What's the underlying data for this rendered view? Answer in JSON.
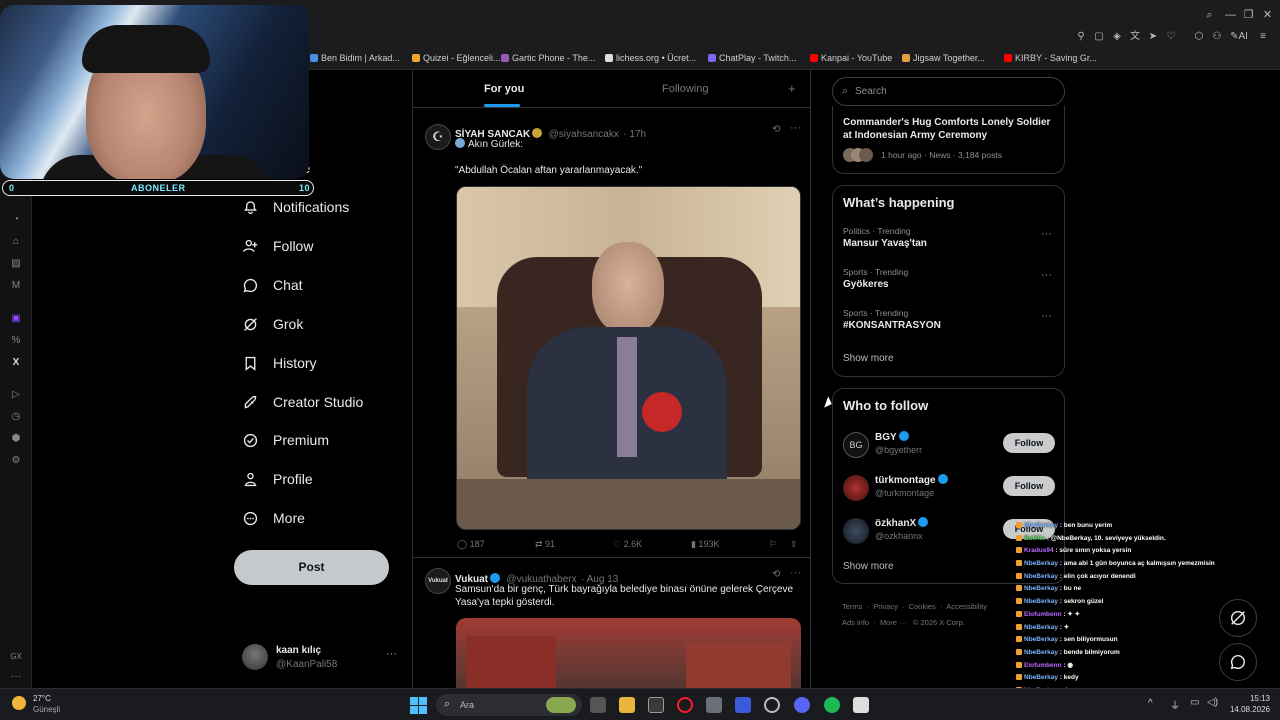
{
  "browser": {
    "bookmarks": [
      {
        "label": "Ben Bidim | Arkad...",
        "color": "#4a90e2"
      },
      {
        "label": "Quizei - Eğlenceli...",
        "color": "#f5a623"
      },
      {
        "label": "Gartic Phone - The...",
        "color": "#9b59b6"
      },
      {
        "label": "lichess.org • Ücret...",
        "color": "#dddddd"
      },
      {
        "label": "ChatPlay - Twitch...",
        "color": "#7b68ee"
      },
      {
        "label": "Kanpai - YouTube",
        "color": "#ff0000"
      },
      {
        "label": "Jigsaw Together...",
        "color": "#e0a040"
      },
      {
        "label": "KIRBY - Saving Gr...",
        "color": "#ff0000"
      }
    ]
  },
  "webcam": {
    "subscriber_label": "ABONELER",
    "sub_current": "0",
    "sub_goal": "10"
  },
  "sidebar": {
    "cut_label": "ore",
    "items": [
      {
        "label": "Notifications",
        "icon": "bell-icon"
      },
      {
        "label": "Follow",
        "icon": "person-add-icon"
      },
      {
        "label": "Chat",
        "icon": "chat-bubble-icon"
      },
      {
        "label": "Grok",
        "icon": "grok-icon"
      },
      {
        "label": "History",
        "icon": "bookmark-icon"
      },
      {
        "label": "Creator Studio",
        "icon": "rocket-icon"
      },
      {
        "label": "Premium",
        "icon": "verified-badge-icon"
      },
      {
        "label": "Profile",
        "icon": "person-icon"
      },
      {
        "label": "More",
        "icon": "more-circle-icon"
      }
    ],
    "post_label": "Post",
    "user": {
      "name": "kaan kılıç",
      "handle": "@KaanPali58"
    }
  },
  "feed": {
    "tabs": [
      "For you",
      "Following"
    ],
    "add_tab": "+",
    "tweets": [
      {
        "name": "SİYAH SANCAK",
        "handle": "@siyahsancakx",
        "time": "· 17h",
        "attribution": "Akın Gürlek:",
        "text": "\"Abdullah Öcalan aftan yararlanmayacak.\"",
        "replies": "187",
        "reposts": "91",
        "likes": "2.6K",
        "views": "193K"
      },
      {
        "name": "Vukuat",
        "handle": "@vukuathaberx",
        "time": "· Aug 13",
        "text": "Samsun'da bir genç, Türk bayrağıyla belediye binası önüne gelerek Çerçeve Yasa'ya tepki gösterdi."
      }
    ]
  },
  "right": {
    "search_placeholder": "Search",
    "news": {
      "title": "Commander's Hug Comforts Lonely Soldier at Indonesian Army Ceremony",
      "meta": "1 hour ago · News · 3,184 posts"
    },
    "happening_title": "What’s happening",
    "trends": [
      {
        "cat": "Politics · Trending",
        "name": "Mansur Yavaş'tan"
      },
      {
        "cat": "Sports · Trending",
        "name": "Gyökeres"
      },
      {
        "cat": "Sports · Trending",
        "name": "#KONSANTRASYON"
      }
    ],
    "show_more": "Show more",
    "wtf_title": "Who to follow",
    "follow_label": "Follow",
    "wtf": [
      {
        "name": "BGY",
        "handle": "@bgyetherr"
      },
      {
        "name": "türkmontage",
        "handle": "@turkmontage"
      },
      {
        "name": "özkhanX",
        "handle": "@ozkhannx"
      }
    ],
    "footer": [
      "Terms",
      "Privacy",
      "Cookies",
      "Accessibility",
      "Ads info",
      "More ···",
      "© 2026 X Corp."
    ]
  },
  "chat": [
    {
      "user": "NbeBerkay",
      "msg": " : ben bunu yerim",
      "color": "#7cb3ff"
    },
    {
      "user": "BotRix",
      "msg": " : @NbeBerkay, 10. seviyeye yükseldin.",
      "color": "#5bd65b"
    },
    {
      "user": "Kradus94",
      "msg": " : süre sının yoksa yersin",
      "color": "#b86bff"
    },
    {
      "user": "NbeBerkay",
      "msg": " : ama abi 1 gün boyunca aç kalmışsın yemezmisin",
      "color": "#7cb3ff"
    },
    {
      "user": "NbeBerkay",
      "msg": " : elin çok acıyor denendi",
      "color": "#7cb3ff"
    },
    {
      "user": "NbeBerkay",
      "msg": " : bu ne",
      "color": "#7cb3ff"
    },
    {
      "user": "NbeBerkay",
      "msg": " : sekron güzel",
      "color": "#7cb3ff"
    },
    {
      "user": "Elofumbenn",
      "msg": " : ✦ ✦",
      "color": "#b86bff"
    },
    {
      "user": "NbeBerkay",
      "msg": " : ✦",
      "color": "#7cb3ff"
    },
    {
      "user": "NbeBerkay",
      "msg": " : sen biliyormusun",
      "color": "#7cb3ff"
    },
    {
      "user": "NbeBerkay",
      "msg": " : bende bilmiyorum",
      "color": "#7cb3ff"
    },
    {
      "user": "Elofumbenn",
      "msg": " : ◉",
      "color": "#b86bff"
    },
    {
      "user": "NbeBerkay",
      "msg": " : kedy",
      "color": "#7cb3ff"
    },
    {
      "user": "NbeBerkay",
      "msg": " : ✦",
      "color": "#7cb3ff"
    },
    {
      "user": "Kradus94",
      "msg": " : ▦",
      "color": "#b86bff"
    }
  ],
  "taskbar": {
    "weather_temp": "27°C",
    "weather_desc": "Güneşli",
    "search_placeholder": "Ara",
    "time": "15:13",
    "date": "14.08.2026"
  }
}
